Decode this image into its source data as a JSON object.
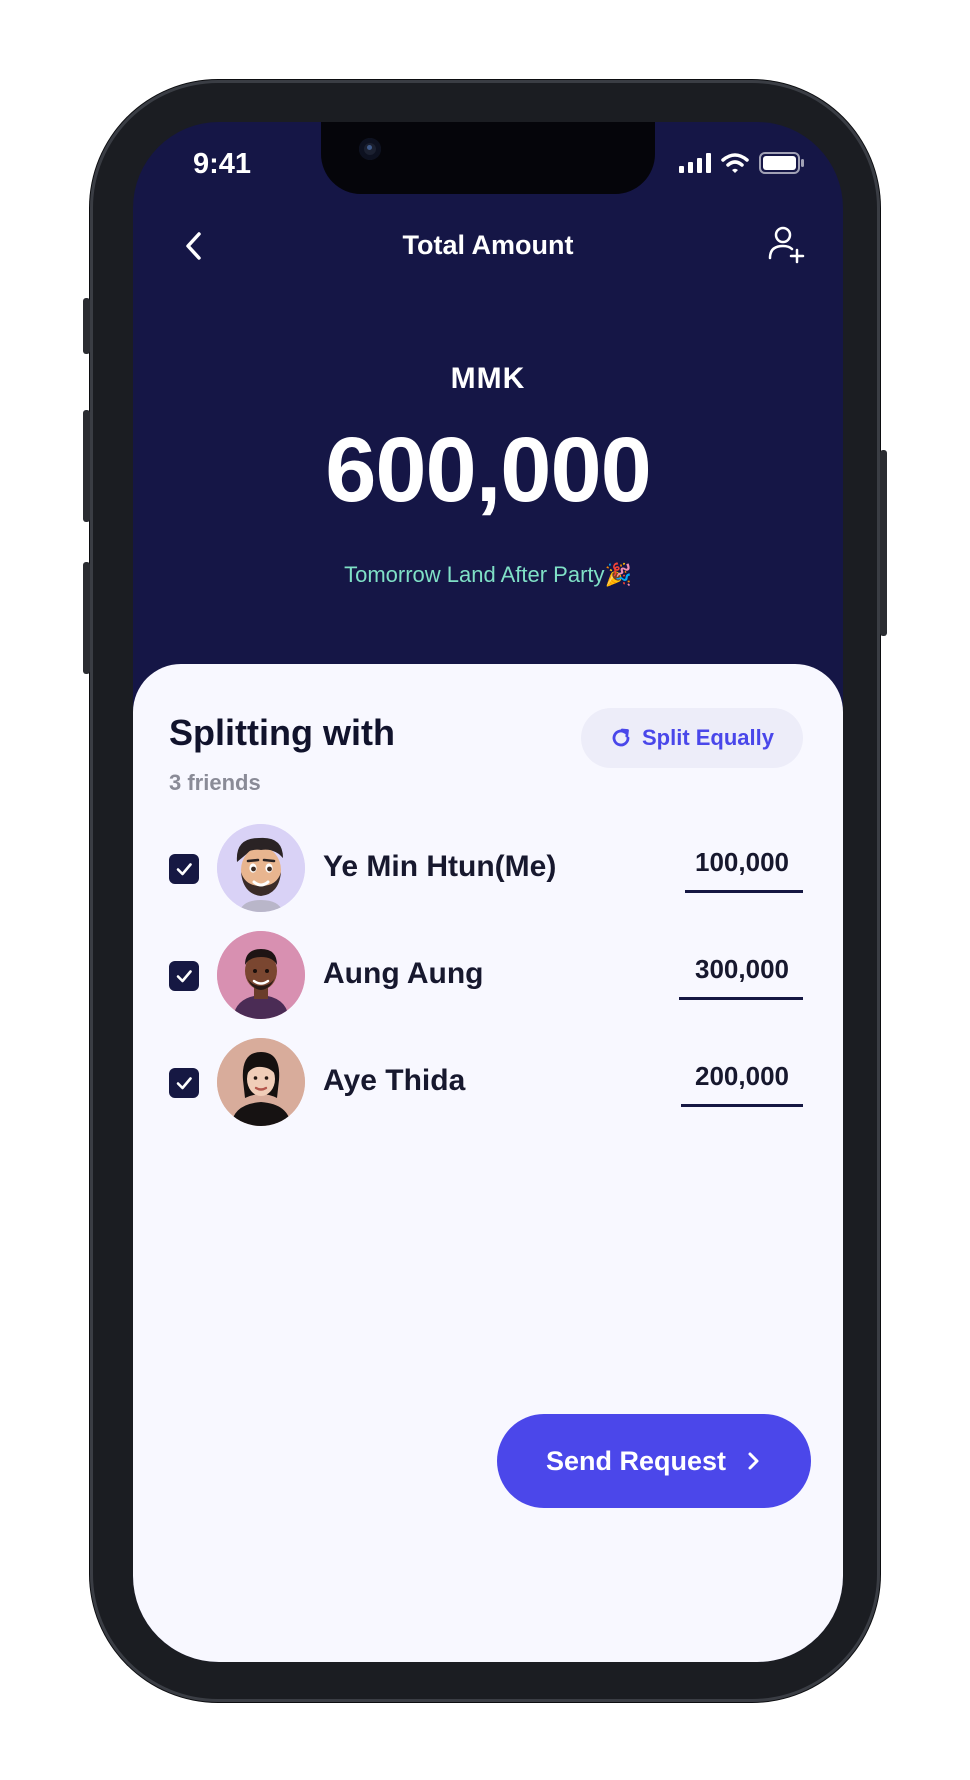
{
  "status_bar": {
    "time": "9:41"
  },
  "header": {
    "title": "Total Amount",
    "back_icon": "chevron-left-icon",
    "add_icon": "add-user-icon"
  },
  "summary": {
    "currency": "MMK",
    "amount": "600,000",
    "note": "Tomorrow Land After Party🎉"
  },
  "splitting": {
    "title": "Splitting with",
    "subtitle": "3 friends",
    "split_equally_label": "Split Equally",
    "friends": [
      {
        "name": "Ye Min Htun(Me)",
        "amount": "100,000",
        "checked": true
      },
      {
        "name": "Aung Aung",
        "amount": "300,000",
        "checked": true
      },
      {
        "name": "Aye Thida",
        "amount": "200,000",
        "checked": true
      }
    ]
  },
  "actions": {
    "send_label": "Send Request"
  },
  "colors": {
    "header_bg": "#151646",
    "accent": "#4b47ea",
    "note_text": "#7fe0c6",
    "card_bg": "#f8f8ff"
  }
}
